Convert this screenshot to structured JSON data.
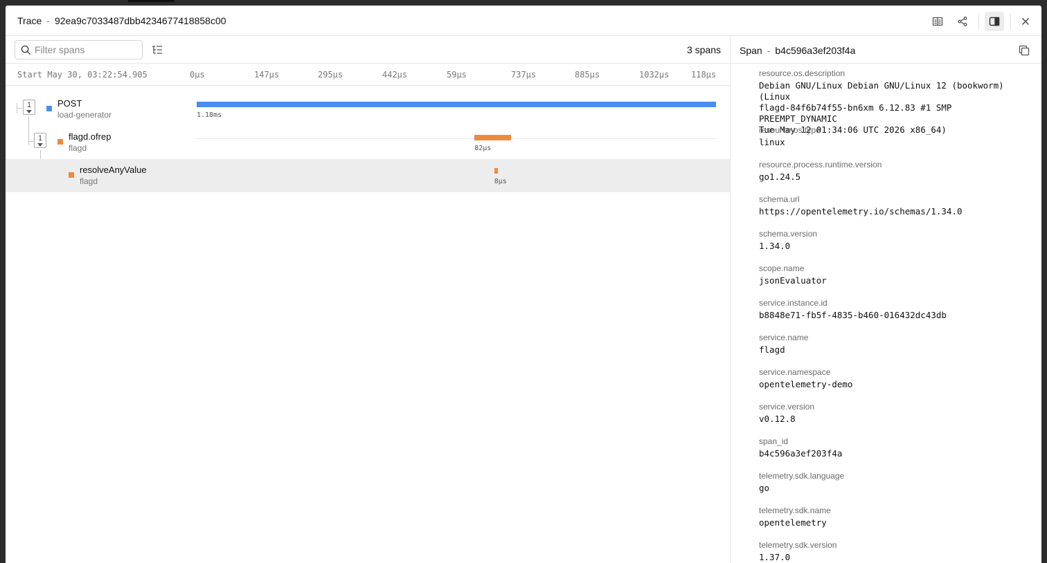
{
  "header": {
    "title_label": "Trace",
    "separator": "-",
    "trace_id": "92ea9c7033487dbb4234677418858c00"
  },
  "toolbar": {
    "search_placeholder": "Filter spans",
    "span_count": "3 spans"
  },
  "timeline": {
    "start_label": "Start May 30, 03:22:54.905",
    "ticks": [
      "0µs",
      "147µs",
      "295µs",
      "442µs",
      "59µs",
      "737µs",
      "885µs",
      "1032µs",
      "118µs"
    ]
  },
  "spans": [
    {
      "name": "POST",
      "service": "load-generator",
      "children_count": "1",
      "duration": "1.18ms",
      "color": "#4a8df1",
      "start_fraction": 0.0,
      "width_fraction": 1.0
    },
    {
      "name": "flagd.ofrep",
      "service": "flagd",
      "children_count": "1",
      "duration": "82µs",
      "color": "#ef8a3c",
      "start_fraction": 0.535,
      "width_fraction": 0.07
    },
    {
      "name": "resolveAnyValue",
      "service": "flagd",
      "children_count": "",
      "duration": "8µs",
      "color": "#ef8a3c",
      "start_fraction": 0.573,
      "width_fraction": 0.007
    }
  ],
  "details": {
    "title_label": "Span",
    "separator": "-",
    "span_id": "b4c596a3ef203f4a",
    "attributes": [
      {
        "key": "resource.os.description",
        "value": "Debian GNU/Linux Debian GNU/Linux 12 (bookworm) (Linux\nflagd-84f6b74f55-bn6xm 6.12.83 #1 SMP PREEMPT_DYNAMIC\nTue May 12 01:34:06 UTC 2026 x86_64)"
      },
      {
        "key": "resource.os.type",
        "value": "linux"
      },
      {
        "key": "resource.process.runtime.version",
        "value": "go1.24.5"
      },
      {
        "key": "schema.url",
        "value": "https://opentelemetry.io/schemas/1.34.0"
      },
      {
        "key": "schema.version",
        "value": "1.34.0"
      },
      {
        "key": "scope.name",
        "value": "jsonEvaluator"
      },
      {
        "key": "service.instance.id",
        "value": "b8848e71-fb5f-4835-b460-016432dc43db"
      },
      {
        "key": "service.name",
        "value": "flagd"
      },
      {
        "key": "service.namespace",
        "value": "opentelemetry-demo"
      },
      {
        "key": "service.version",
        "value": "v0.12.8"
      },
      {
        "key": "span_id",
        "value": "b4c596a3ef203f4a"
      },
      {
        "key": "telemetry.sdk.language",
        "value": "go"
      },
      {
        "key": "telemetry.sdk.name",
        "value": "opentelemetry"
      },
      {
        "key": "telemetry.sdk.version",
        "value": "1.37.0"
      }
    ]
  },
  "icons": {
    "header": [
      "table-view-icon",
      "share-icon",
      "sidebar-panel-icon",
      "close-icon"
    ],
    "search": "search-icon",
    "tree": "tree-view-icon",
    "copy": "copy-icon"
  }
}
